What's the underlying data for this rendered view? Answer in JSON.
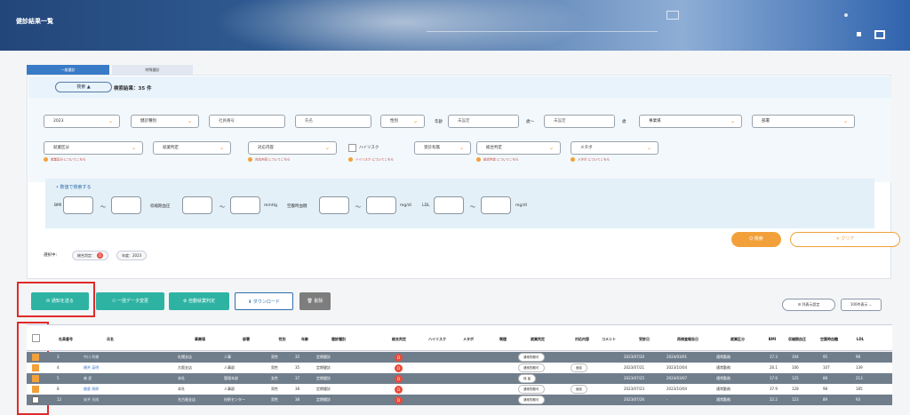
{
  "header": {
    "title": "健診結果一覧"
  },
  "tabs": [
    "一般健診",
    "特殊健診"
  ],
  "search": {
    "toggle": "検索 ▲",
    "result": "検索結果：35 件"
  },
  "filters": {
    "year": "2023",
    "exam_type": "健診種別",
    "employee_no_ph": "社員番号",
    "name_ph": "氏名",
    "sex": "性別",
    "age_label": "年齢",
    "age_from_ph": "未設定",
    "age_sep": "歳〜",
    "age_to_ph": "未設定",
    "age_unit": "歳",
    "office": "事業場",
    "dept": "部署",
    "work_class": "就業区分",
    "work_judgment": "就業判定",
    "response": "対応内容",
    "high_risk": "ハイリスク",
    "consult": "受診有無",
    "overall": "総合判定",
    "metabo": "メタボ",
    "help_work_class": "就業区分 についてこちら",
    "help_response": "対応内容 についてこちら",
    "help_high_risk": "ハイリスク についてこちら",
    "help_overall": "総合判定 についてこちら",
    "help_metabo": "メタボ についてこちら"
  },
  "numeric": {
    "title": "• 数値で検索する",
    "bmi": "BMI",
    "tilde": "〜",
    "sbp": "収縮期血圧",
    "mmhg": "mmHg",
    "fbs": "空腹時血糖",
    "mgdl": "mg/dl",
    "ldl": "LDL"
  },
  "actions": {
    "search": "Q 検索",
    "clear": "✕ クリア"
  },
  "selected": {
    "label": "選択中：",
    "chip1": "総合判定：",
    "chip1_badge": "D",
    "chip2": "年度：2023"
  },
  "toolbar": {
    "notify": "✉ 通知を送る",
    "bulk": "一括データ変更",
    "auto": "自動就業判定",
    "download": "ダウンロード",
    "delete": "削除",
    "cols": "列表示設定",
    "per_page": "100件表示"
  },
  "columns": [
    "社員番号",
    "氏名",
    "事業場",
    "部署",
    "性別",
    "年齢",
    "健診種別",
    "総合判定",
    "ハイリスク",
    "メタボ",
    "喫煙",
    "就業判定",
    "対応内容",
    "コメント",
    "受診日",
    "再検査報告日",
    "就業区分",
    "BMI",
    "収縮期血圧",
    "空腹時血糖",
    "LDL"
  ],
  "rows": [
    {
      "no": "3",
      "name": "中川 利樹",
      "office": "札幌支店",
      "dept": "人事",
      "sex": "男性",
      "age": "35",
      "type": "定期健診",
      "grade": "D",
      "work": "通常勤務可",
      "resp": "",
      "date": "2023/07/20",
      "redate": "2024/03/01",
      "cls": "通常勤務",
      "bmi": "17.3",
      "sbp": "104",
      "fbs": "95",
      "ldl": "98",
      "checked": true
    },
    {
      "no": "4",
      "name": "横井 英明",
      "office": "大阪支店",
      "dept": "人事部",
      "sex": "男性",
      "age": "35",
      "type": "定期健診",
      "grade": "D",
      "work": "通常勤務可",
      "resp": "面談",
      "date": "2023/07/21",
      "redate": "2023/10/04",
      "cls": "通常勤務",
      "bmi": "26.1",
      "sbp": "106",
      "fbs": "107",
      "ldl": "139",
      "checked": true
    },
    {
      "no": "5",
      "name": "森 愛",
      "office": "本社",
      "dept": "管理本部",
      "sex": "女性",
      "age": "37",
      "type": "定期健診",
      "grade": "D",
      "work": "保 留",
      "resp": "",
      "date": "2023/07/25",
      "redate": "2024/03/07",
      "cls": "通常勤務",
      "bmi": "17.6",
      "sbp": "125",
      "fbs": "88",
      "ldl": "213",
      "checked": true
    },
    {
      "no": "8",
      "name": "額倉 周郎",
      "office": "本社",
      "dept": "人事部",
      "sex": "男性",
      "age": "38",
      "type": "定期健診",
      "grade": "D",
      "work": "通常勤務可",
      "resp": "面談",
      "date": "2023/07/23",
      "redate": "2023/10/04",
      "cls": "通常勤務",
      "bmi": "37.9",
      "sbp": "128",
      "fbs": "98",
      "ldl": "185",
      "checked": true
    },
    {
      "no": "12",
      "name": "安井 光成",
      "office": "名古屋支店",
      "dept": "技術センター",
      "sex": "男性",
      "age": "38",
      "type": "定期健診",
      "grade": "D",
      "work": "通常勤務可",
      "resp": "",
      "date": "2023/07/26",
      "redate": "-",
      "cls": "通常勤務",
      "bmi": "22.2",
      "sbp": "123",
      "fbs": "89",
      "ldl": "93",
      "checked": false
    }
  ],
  "colors": {
    "accent": "#f2a13a",
    "primary": "#3a7bc8",
    "notify": "#2eb3a3",
    "danger": "#e74c3c"
  }
}
